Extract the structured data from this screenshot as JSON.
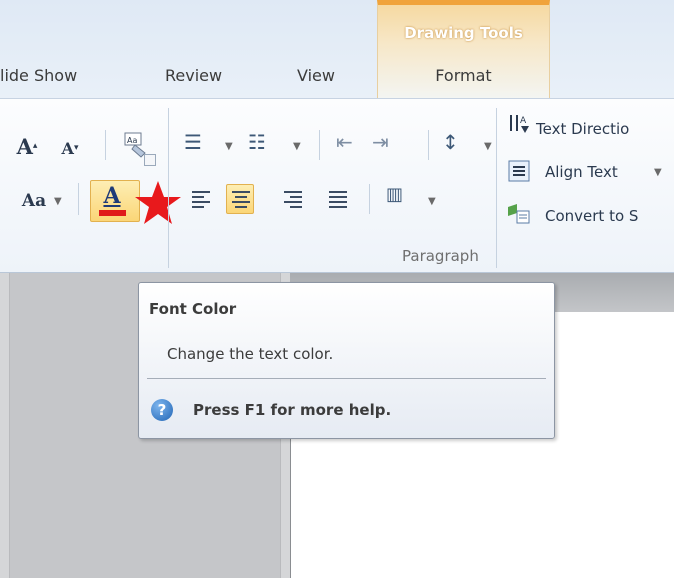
{
  "tabs": {
    "slide_show": "lide Show",
    "review": "Review",
    "view": "View",
    "contextual_group": "Drawing Tools",
    "format": "Format"
  },
  "font_group": {
    "grow_font": "A",
    "shrink_font": "A",
    "change_case": "Aa",
    "font_color_glyph": "A",
    "font_color_bar_color": "#e01a1a"
  },
  "paragraph_group": {
    "label": "Paragraph",
    "active_alignment": "center"
  },
  "text_group": {
    "text_direction": "Text Directio",
    "align_text": "Align Text",
    "convert": "Convert to S"
  },
  "tooltip": {
    "title": "Font Color",
    "description": "Change the text color.",
    "help_icon": "?",
    "help": "Press F1 for more help."
  },
  "icons": [
    "grow-font-icon",
    "shrink-font-icon",
    "clear-formatting-icon",
    "bullets-icon",
    "numbering-icon",
    "decrease-indent-icon",
    "increase-indent-icon",
    "line-spacing-icon",
    "columns-icon",
    "text-direction-icon",
    "align-text-icon",
    "smartart-icon",
    "help-icon",
    "star-marker-icon"
  ],
  "colors": {
    "accent_orange": "#f0a33b",
    "active_button": "#fbd677",
    "marker_star": "#e8191c"
  }
}
